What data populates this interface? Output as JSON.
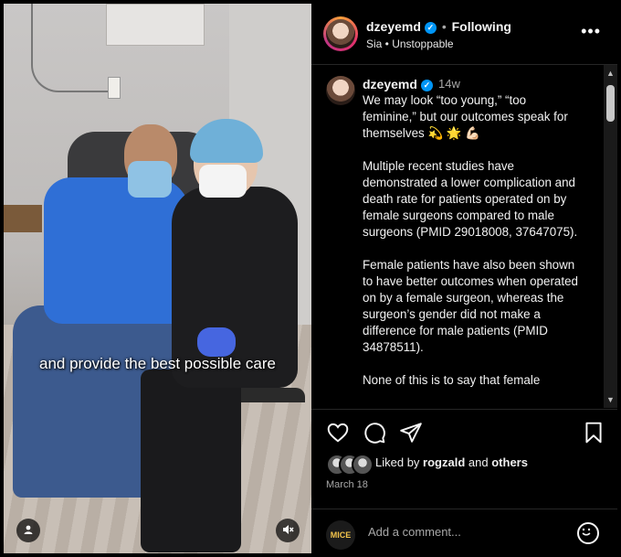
{
  "post": {
    "author": "dzeyemd",
    "following_label": "Following",
    "audio": "Sia • Unstoppable",
    "more_label": "•••"
  },
  "media": {
    "video_caption": "and provide the best possible care"
  },
  "caption": {
    "author": "dzeyemd",
    "time": "14w",
    "paragraphs": [
      "We may look “too young,” “too feminine,” but our outcomes speak for themselves 💫 🌟 💪🏻",
      "Multiple recent studies have demonstrated a lower complication and death rate for patients operated on by female surgeons compared to male surgeons (PMID 29018008, 37647075).",
      "Female patients have also been shown to have better outcomes when operated on by a female surgeon, whereas the surgeon’s gender did not make a difference for male patients (PMID 34878511).",
      "None of this is to say that female"
    ]
  },
  "engagement": {
    "liked_by_prefix": "Liked by",
    "liked_by_user": "rogzald",
    "liked_and": "and",
    "liked_others": "others",
    "date": "March 18"
  },
  "comment": {
    "avatar_text": "MICE",
    "placeholder": "Add a comment..."
  },
  "icons": {
    "heart": "heart-icon",
    "comment": "comment-icon",
    "share": "share-icon",
    "save": "bookmark-icon"
  }
}
